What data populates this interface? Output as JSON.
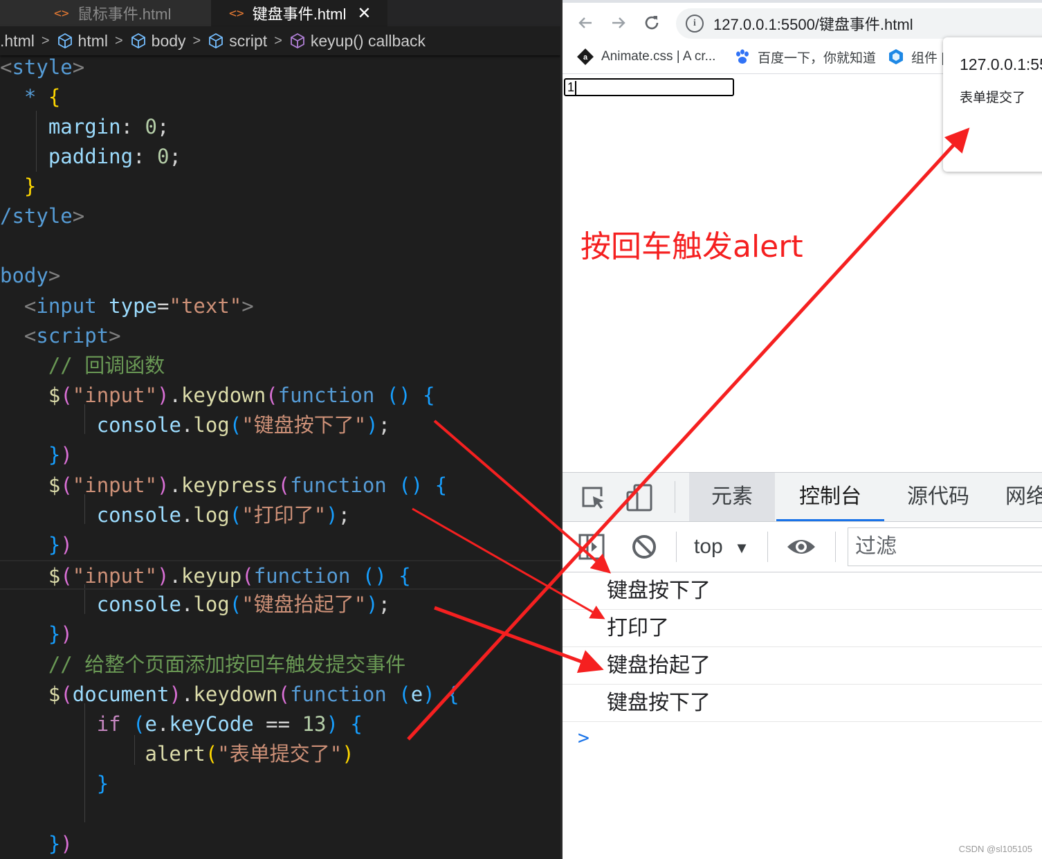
{
  "editor": {
    "tabs": [
      {
        "label": "鼠标事件.html"
      },
      {
        "label": "键盘事件.html",
        "close": "✕"
      }
    ],
    "breadcrumb": [
      ".html",
      "html",
      "body",
      "script",
      "keyup() callback"
    ],
    "code": {
      "style_open": "style",
      "star": "*",
      "brace_open": "{",
      "margin_prop": "margin",
      "margin_val": "0",
      "padding_prop": "padding",
      "padding_val": "0",
      "brace_close": "}",
      "style_close": "/style",
      "body_open": "body",
      "input_tag": "input",
      "input_attr": "type",
      "input_val": "\"text\"",
      "script_tag": "script",
      "comment1": "// 回调函数",
      "sel_input": "\"input\"",
      "keydown": "keydown",
      "keypress": "keypress",
      "keyup": "keyup",
      "function_kw": "function",
      "console": "console",
      "log": "log",
      "str_keydown": "\"键盘按下了\"",
      "str_keypress": "\"打印了\"",
      "str_keyup": "\"键盘抬起了\"",
      "comment2": "// 给整个页面添加按回车触发提交事件",
      "document_kw": "document",
      "param_e": "e",
      "if_kw": "if",
      "keycode": "keyCode",
      "eq": "==",
      "num13": "13",
      "alert_fn": "alert",
      "str_alert": "\"表单提交了\""
    }
  },
  "browser": {
    "url": "127.0.0.1:5500/键盘事件.html",
    "bookmarks": [
      "Animate.css | A cr...",
      "百度一下，你就知道",
      "组件 |"
    ],
    "input_value": "1",
    "annotation": "按回车触发alert",
    "alert": {
      "origin": "127.0.0.1:55",
      "message": "表单提交了"
    },
    "devtools": {
      "tabs": [
        "元素",
        "控制台",
        "源代码",
        "网络"
      ],
      "context": "top",
      "filter_placeholder": "过滤",
      "messages": [
        "键盘按下了",
        "打印了",
        "键盘抬起了",
        "键盘按下了"
      ]
    },
    "watermark": "CSDN @sl105105"
  },
  "colors": {
    "arrow": "#f52020",
    "accent": "#1a73e8"
  }
}
